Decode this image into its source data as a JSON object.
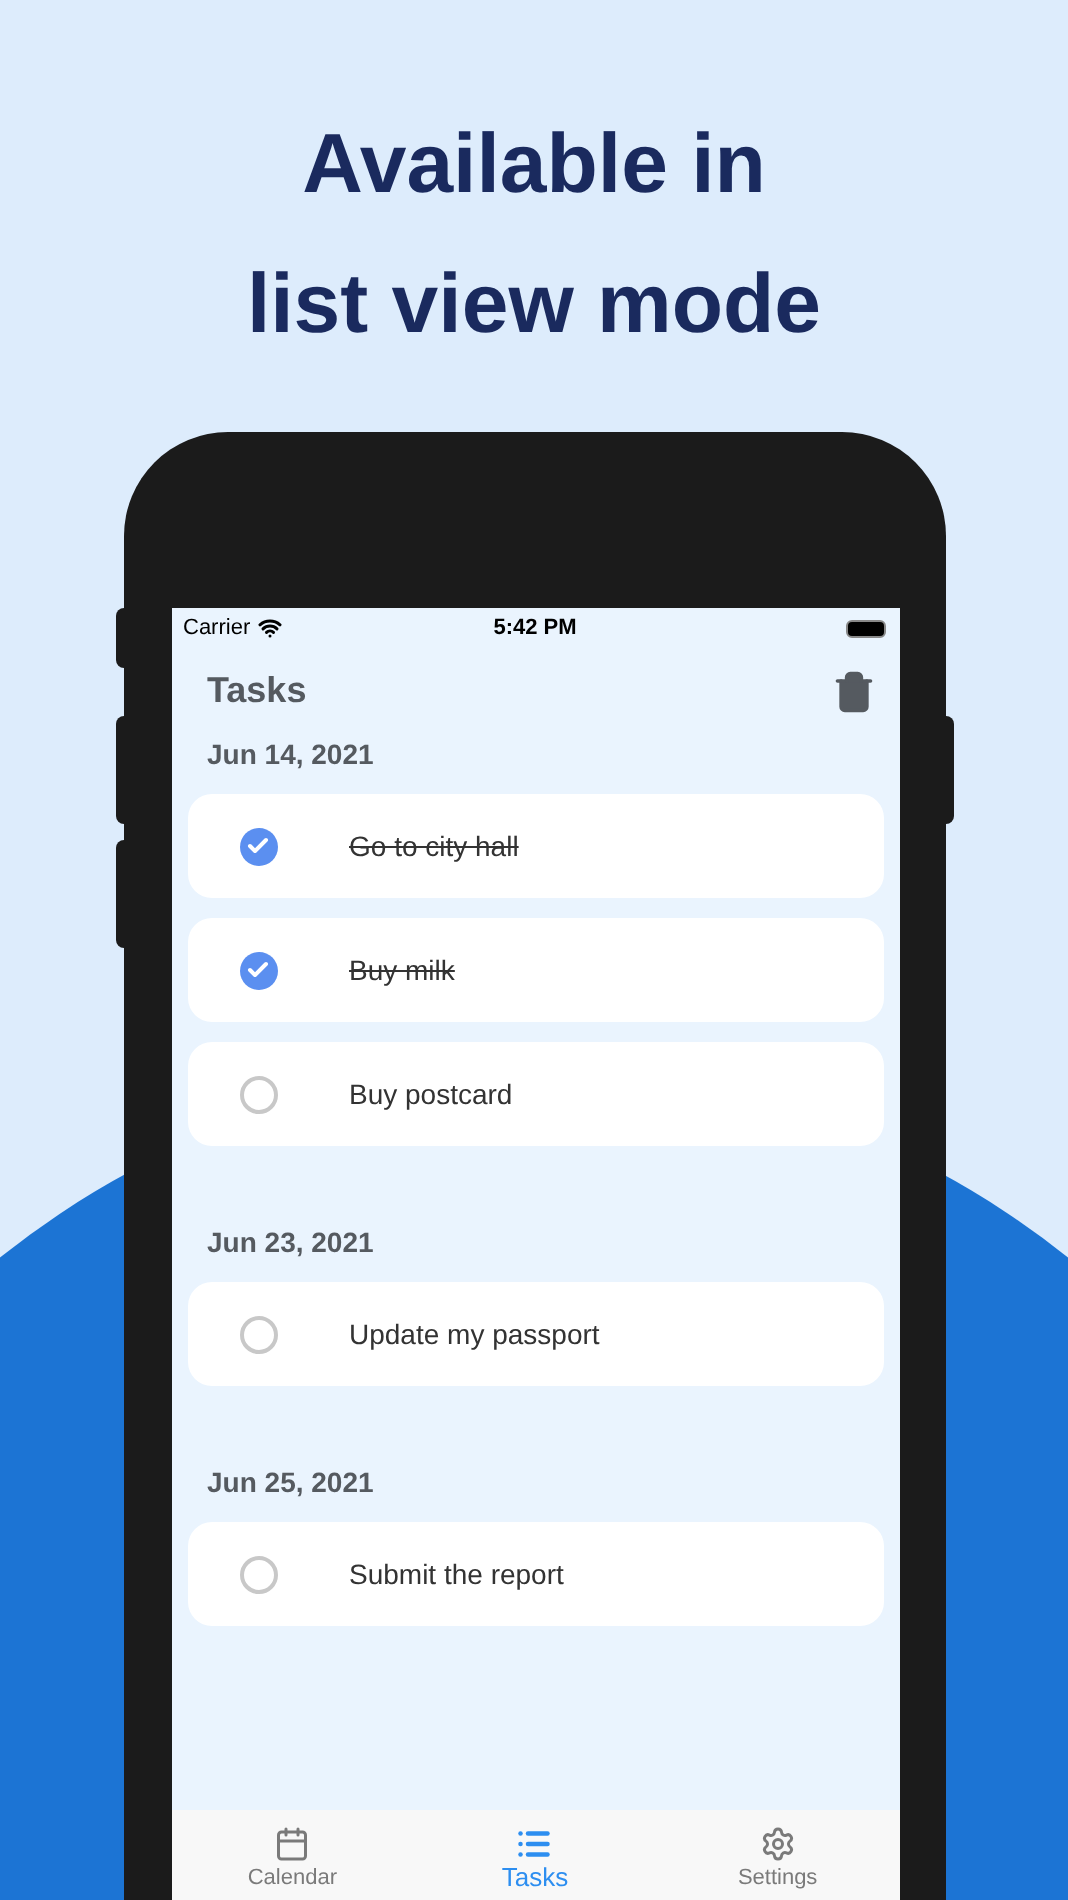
{
  "headline": [
    "Available in",
    "list view mode"
  ],
  "status_bar": {
    "carrier": "Carrier",
    "time": "5:42 PM"
  },
  "title": "Tasks",
  "groups": [
    {
      "date": "Jun 14, 2021",
      "tasks": [
        {
          "title": "Go to city hall",
          "done": true
        },
        {
          "title": "Buy milk",
          "done": true
        },
        {
          "title": "Buy postcard",
          "done": false
        }
      ]
    },
    {
      "date": "Jun 23, 2021",
      "tasks": [
        {
          "title": "Update my passport",
          "done": false
        }
      ]
    },
    {
      "date": "Jun 25, 2021",
      "tasks": [
        {
          "title": "Submit the report",
          "done": false
        }
      ]
    }
  ],
  "tabs": [
    {
      "kind": "calendar",
      "label": "Calendar",
      "selected": false
    },
    {
      "kind": "list",
      "label": "Tasks",
      "selected": true
    },
    {
      "kind": "settings",
      "label": "Settings",
      "selected": false
    }
  ]
}
